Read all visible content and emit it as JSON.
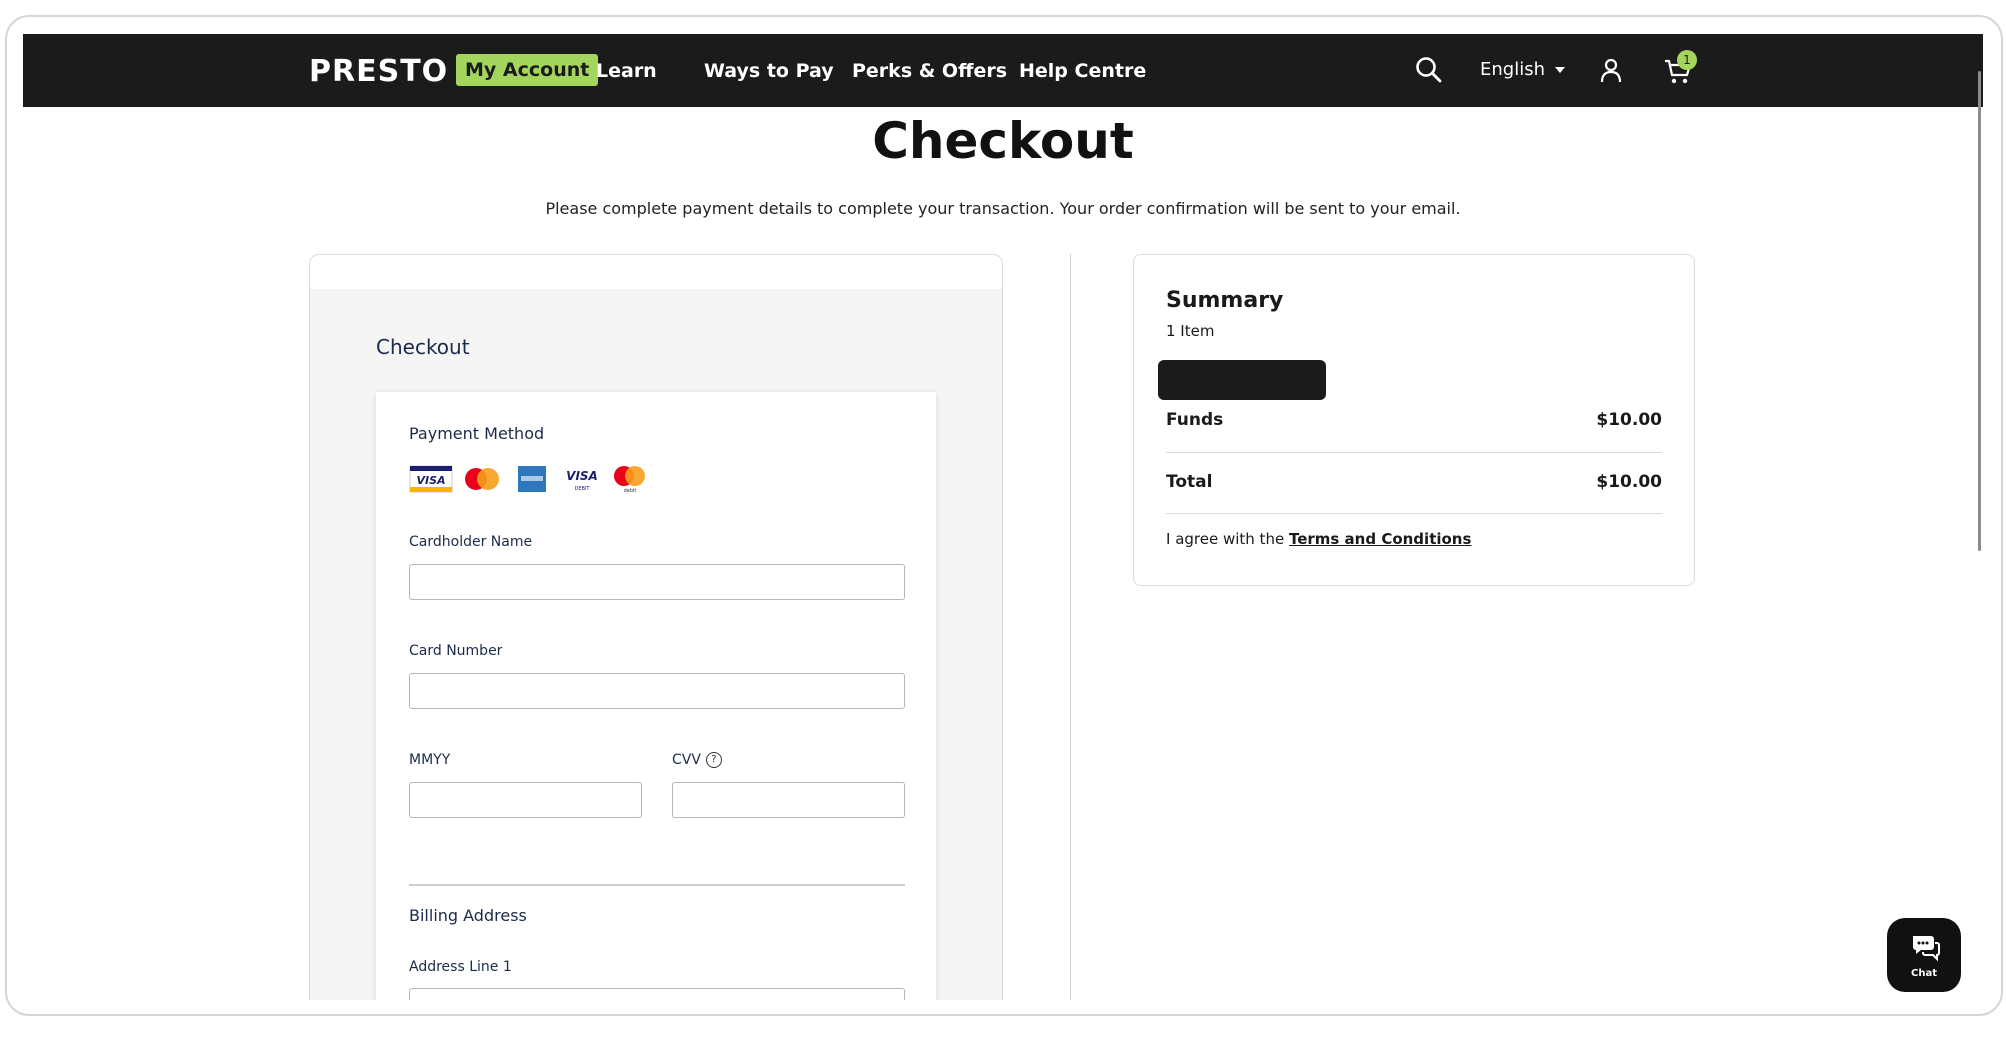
{
  "nav": {
    "logo": "PRESTO",
    "links": [
      {
        "label": "My Account",
        "active": true
      },
      {
        "label": "Learn"
      },
      {
        "label": "Ways to Pay"
      },
      {
        "label": "Perks & Offers"
      },
      {
        "label": "Help Centre"
      }
    ],
    "language": "English",
    "cart_count": "1",
    "accent_color": "#a4d65e",
    "icons": [
      "search-icon",
      "caret-down-icon",
      "user-icon",
      "cart-icon"
    ]
  },
  "page": {
    "title": "Checkout",
    "subtitle": "Please complete payment details to complete your transaction. Your order confirmation will be sent to your email."
  },
  "checkout_form": {
    "heading": "Checkout",
    "payment_method_label": "Payment Method",
    "card_brands": [
      "visa",
      "mastercard",
      "amex",
      "visa-debit",
      "mastercard-debit"
    ],
    "cardholder_name": {
      "label": "Cardholder Name",
      "value": ""
    },
    "card_number": {
      "label": "Card Number",
      "value": ""
    },
    "mmyy": {
      "label": "MMYY",
      "value": ""
    },
    "cvv": {
      "label": "CVV",
      "value": ""
    },
    "billing_address_label": "Billing Address",
    "address_line_1": {
      "label": "Address Line 1",
      "value": ""
    }
  },
  "summary": {
    "title": "Summary",
    "item_count": "1 Item",
    "funds_label": "Funds",
    "funds_value": "$10.00",
    "total_label": "Total",
    "total_value": "$10.00",
    "terms_prefix": "I agree with the",
    "terms_link": "Terms and Conditions"
  },
  "chat": {
    "label": "Chat"
  }
}
